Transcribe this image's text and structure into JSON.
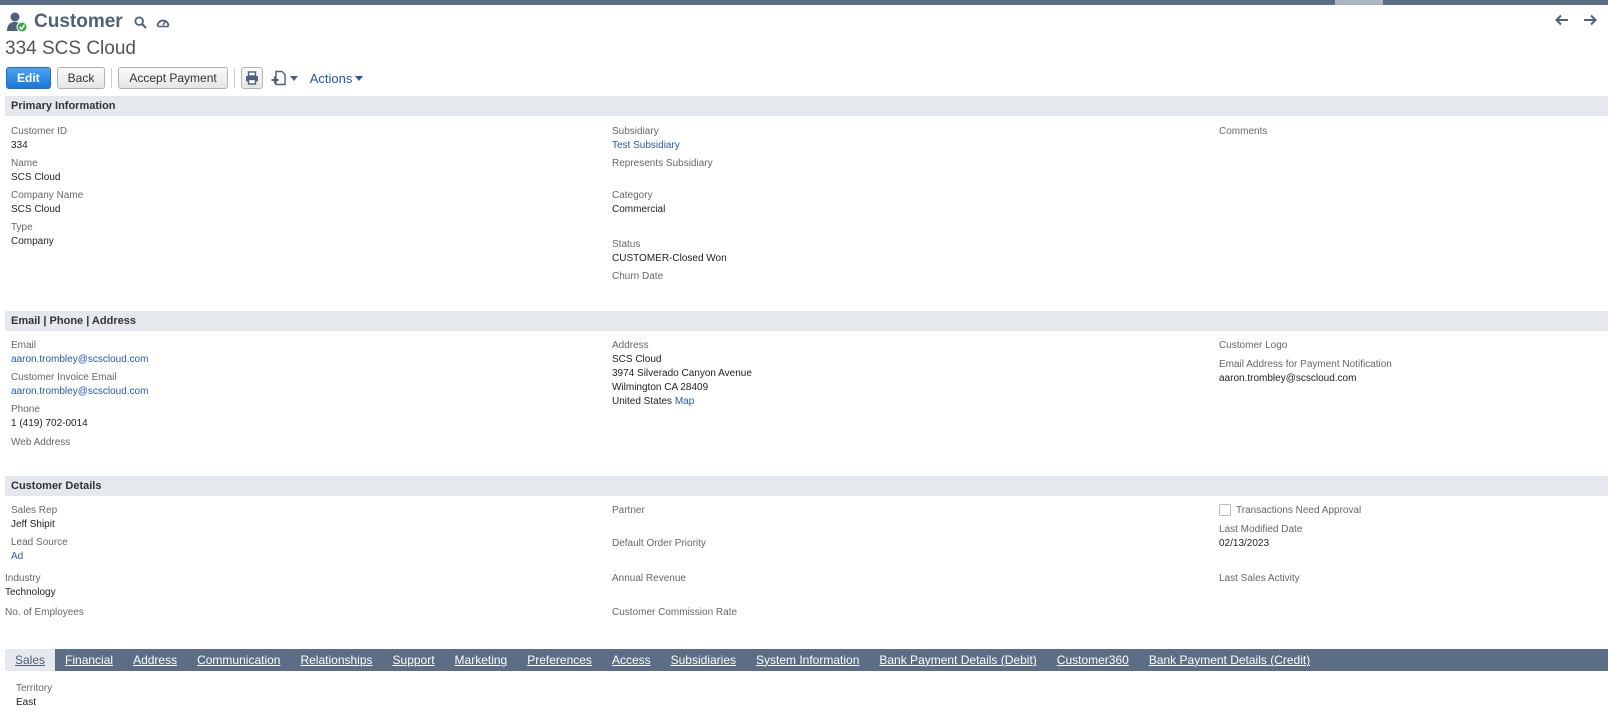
{
  "colors": {
    "accent": "#4d5f79",
    "link": "#255aa8",
    "tabbar": "#5c6e86",
    "section_bg": "#e5e8ec",
    "primary_button": "#1c76d6"
  },
  "header": {
    "record_type": "Customer",
    "record_icon": "customer-icon",
    "search_icon": "search-icon",
    "dashboard_icon": "dashboard-icon",
    "record_title": "334 SCS Cloud",
    "nav_back_icon": "arrow-left-icon",
    "nav_forward_icon": "arrow-right-icon"
  },
  "toolbar": {
    "edit_label": "Edit",
    "back_label": "Back",
    "accept_payment_label": "Accept Payment",
    "print_icon": "print-icon",
    "new_doc_icon": "new-document-icon",
    "actions_label": "Actions"
  },
  "primary_info": {
    "title": "Primary Information",
    "customer_id": {
      "label": "Customer ID",
      "value": "334"
    },
    "name": {
      "label": "Name",
      "value": "SCS Cloud"
    },
    "company_name": {
      "label": "Company Name",
      "value": "SCS Cloud"
    },
    "type": {
      "label": "Type",
      "value": "Company"
    },
    "subsidiary": {
      "label": "Subsidiary",
      "value": "Test Subsidiary"
    },
    "represents_subsidiary": {
      "label": "Represents Subsidiary",
      "value": ""
    },
    "category": {
      "label": "Category",
      "value": "Commercial"
    },
    "status": {
      "label": "Status",
      "value": "CUSTOMER-Closed Won"
    },
    "churn_date": {
      "label": "Churn Date",
      "value": ""
    },
    "comments": {
      "label": "Comments",
      "value": ""
    }
  },
  "contact": {
    "title": "Email | Phone | Address",
    "email": {
      "label": "Email",
      "value": "aaron.trombley@scscloud.com"
    },
    "invoice_email": {
      "label": "Customer Invoice Email",
      "value": "aaron.trombley@scscloud.com"
    },
    "phone": {
      "label": "Phone",
      "value": "1 (419) 702-0014"
    },
    "web_address": {
      "label": "Web Address",
      "value": ""
    },
    "address": {
      "label": "Address",
      "line1": "SCS Cloud",
      "line2": "3974 Silverado Canyon Avenue",
      "line3": "Wilmington CA 28409",
      "country": "United States",
      "map_link": "Map"
    },
    "customer_logo": {
      "label": "Customer Logo",
      "value": ""
    },
    "payment_notification_email": {
      "label": "Email Address for Payment Notification",
      "value": "aaron.trombley@scscloud.com"
    }
  },
  "details": {
    "title": "Customer Details",
    "sales_rep": {
      "label": "Sales Rep",
      "value": "Jeff Shipit"
    },
    "lead_source": {
      "label": "Lead Source",
      "value": "Ad"
    },
    "industry": {
      "label": "Industry",
      "value": "Technology"
    },
    "employees": {
      "label": "No. of Employees",
      "value": ""
    },
    "partner": {
      "label": "Partner",
      "value": ""
    },
    "default_order_priority": {
      "label": "Default Order Priority",
      "value": ""
    },
    "annual_revenue": {
      "label": "Annual Revenue",
      "value": ""
    },
    "commission_rate": {
      "label": "Customer Commission Rate",
      "value": ""
    },
    "transactions_need_approval": {
      "label": "Transactions Need Approval",
      "checked": false
    },
    "last_modified": {
      "label": "Last Modified Date",
      "value": "02/13/2023"
    },
    "last_sales_activity": {
      "label": "Last Sales Activity",
      "value": ""
    }
  },
  "tabs": [
    {
      "label": "Sales",
      "active": true
    },
    {
      "label": "Financial",
      "active": false
    },
    {
      "label": "Address",
      "active": false
    },
    {
      "label": "Communication",
      "active": false
    },
    {
      "label": "Relationships",
      "active": false
    },
    {
      "label": "Support",
      "active": false
    },
    {
      "label": "Marketing",
      "active": false
    },
    {
      "label": "Preferences",
      "active": false
    },
    {
      "label": "Access",
      "active": false
    },
    {
      "label": "Subsidiaries",
      "active": false
    },
    {
      "label": "System Information",
      "active": false
    },
    {
      "label": "Bank Payment Details (Debit)",
      "active": false
    },
    {
      "label": "Customer360",
      "active": false
    },
    {
      "label": "Bank Payment Details (Credit)",
      "active": false
    }
  ],
  "sales_tab": {
    "territory": {
      "label": "Territory",
      "value": "East"
    }
  }
}
